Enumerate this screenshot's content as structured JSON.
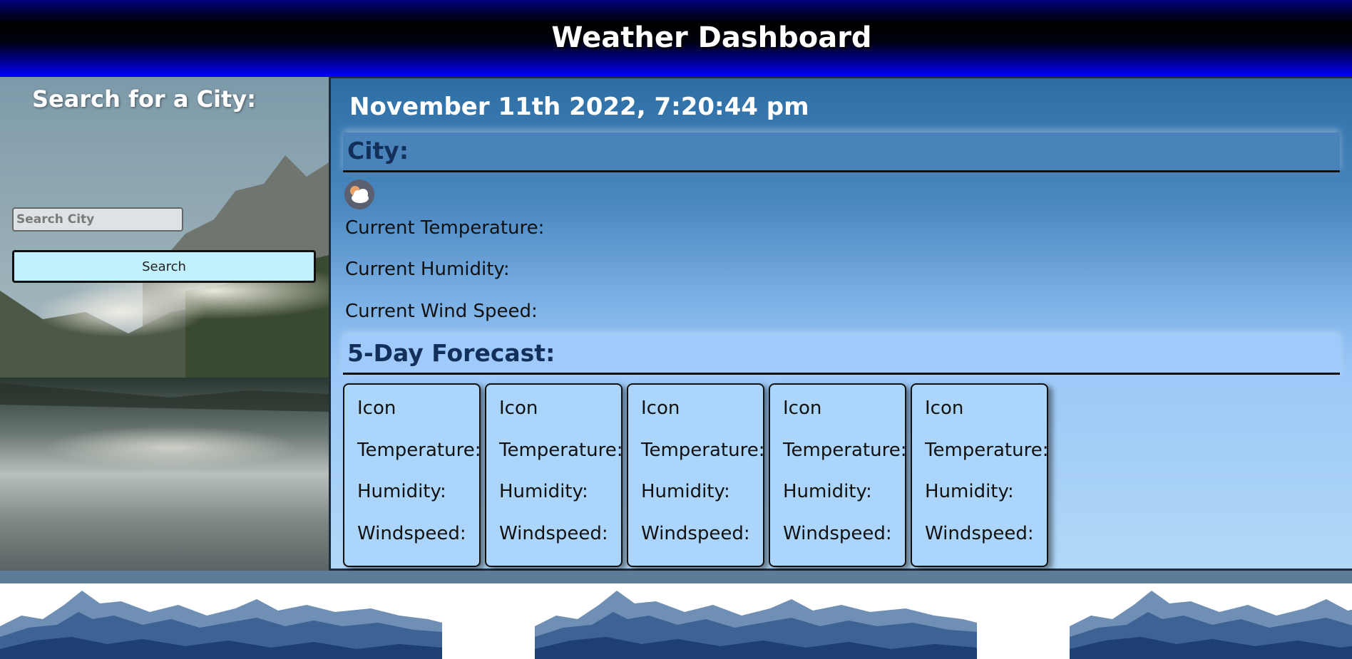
{
  "header": {
    "title": "Weather Dashboard"
  },
  "sidebar": {
    "heading": "Search for a City:",
    "search_placeholder": "Search City",
    "search_button": "Search"
  },
  "main": {
    "datetime": "November 11th 2022, 7:20:44 pm",
    "city_label": "City:",
    "current_icon": "partly-cloudy-night-icon",
    "current_temperature_label": "Current Temperature:",
    "current_humidity_label": "Current Humidity:",
    "current_wind_label": "Current Wind Speed:",
    "forecast_heading": "5-Day Forecast:",
    "forecast": [
      {
        "icon": "Icon",
        "temperature": "Temperature:",
        "humidity": "Humidity:",
        "windspeed": "Windspeed:"
      },
      {
        "icon": "Icon",
        "temperature": "Temperature:",
        "humidity": "Humidity:",
        "windspeed": "Windspeed:"
      },
      {
        "icon": "Icon",
        "temperature": "Temperature:",
        "humidity": "Humidity:",
        "windspeed": "Windspeed:"
      },
      {
        "icon": "Icon",
        "temperature": "Temperature:",
        "humidity": "Humidity:",
        "windspeed": "Windspeed:"
      },
      {
        "icon": "Icon",
        "temperature": "Temperature:",
        "humidity": "Humidity:",
        "windspeed": "Windspeed:"
      }
    ]
  },
  "colors": {
    "header_start": "#00007a",
    "header_end": "#0000ff",
    "button_bg": "#c3f0fd",
    "city_bar": "#4a83ba",
    "forecast_bar": "#a0cafc",
    "card_bg": "#abd5fa",
    "heading_text": "#12305a"
  }
}
